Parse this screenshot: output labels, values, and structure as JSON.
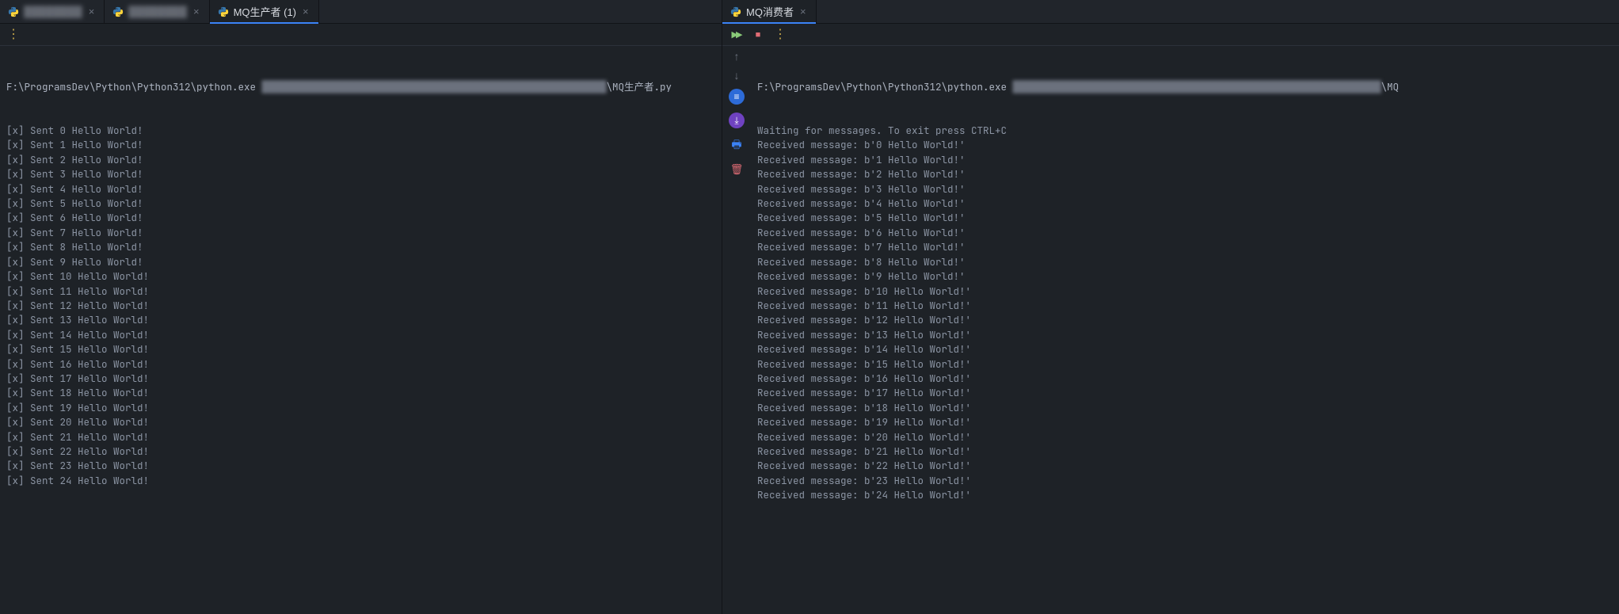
{
  "left": {
    "tabs": [
      {
        "label": "████████",
        "active": false,
        "blurred": true
      },
      {
        "label": "████████",
        "active": false,
        "blurred": true
      },
      {
        "label": "MQ生产者 (1)",
        "active": true,
        "blurred": false
      }
    ],
    "cmd_prefix": "F:\\ProgramsDev\\Python\\Python312\\python.exe ",
    "cmd_args_blurred": "██████████████████████████████████████████████████████████",
    "cmd_tail": "\\MQ生产者.py",
    "lines": [
      "[x] Sent 0 Hello World!",
      "[x] Sent 1 Hello World!",
      "[x] Sent 2 Hello World!",
      "[x] Sent 3 Hello World!",
      "[x] Sent 4 Hello World!",
      "[x] Sent 5 Hello World!",
      "[x] Sent 6 Hello World!",
      "[x] Sent 7 Hello World!",
      "[x] Sent 8 Hello World!",
      "[x] Sent 9 Hello World!",
      "[x] Sent 10 Hello World!",
      "[x] Sent 11 Hello World!",
      "[x] Sent 12 Hello World!",
      "[x] Sent 13 Hello World!",
      "[x] Sent 14 Hello World!",
      "[x] Sent 15 Hello World!",
      "[x] Sent 16 Hello World!",
      "[x] Sent 17 Hello World!",
      "[x] Sent 18 Hello World!",
      "[x] Sent 19 Hello World!",
      "[x] Sent 20 Hello World!",
      "[x] Sent 21 Hello World!",
      "[x] Sent 22 Hello World!",
      "[x] Sent 23 Hello World!",
      "[x] Sent 24 Hello World!"
    ]
  },
  "right": {
    "tabs": [
      {
        "label": "MQ消费者",
        "active": true,
        "blurred": false
      }
    ],
    "cmd_prefix": "F:\\ProgramsDev\\Python\\Python312\\python.exe ",
    "cmd_args_blurred": "██████████████████████████████████████████████████████████████",
    "cmd_tail": "\\MQ",
    "lines": [
      "Waiting for messages. To exit press CTRL+C",
      "Received message: b'0 Hello World!'",
      "Received message: b'1 Hello World!'",
      "Received message: b'2 Hello World!'",
      "Received message: b'3 Hello World!'",
      "Received message: b'4 Hello World!'",
      "Received message: b'5 Hello World!'",
      "Received message: b'6 Hello World!'",
      "Received message: b'7 Hello World!'",
      "Received message: b'8 Hello World!'",
      "Received message: b'9 Hello World!'",
      "Received message: b'10 Hello World!'",
      "Received message: b'11 Hello World!'",
      "Received message: b'12 Hello World!'",
      "Received message: b'13 Hello World!'",
      "Received message: b'14 Hello World!'",
      "Received message: b'15 Hello World!'",
      "Received message: b'16 Hello World!'",
      "Received message: b'17 Hello World!'",
      "Received message: b'18 Hello World!'",
      "Received message: b'19 Hello World!'",
      "Received message: b'20 Hello World!'",
      "Received message: b'21 Hello World!'",
      "Received message: b'22 Hello World!'",
      "Received message: b'23 Hello World!'",
      "Received message: b'24 Hello World!'"
    ]
  },
  "icons": {
    "more": "⋮",
    "rerun": "▶▶",
    "stop": "■",
    "scroll_up": "↑",
    "scroll_down": "↓",
    "wrap": "≡",
    "scroll_end": "⤓",
    "print": "🖶",
    "trash": "🗑"
  }
}
